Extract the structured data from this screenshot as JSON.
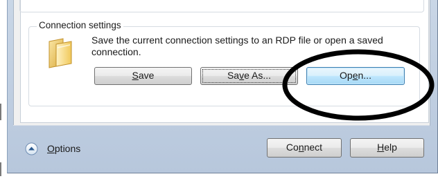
{
  "connection_settings": {
    "legend": "Connection settings",
    "description": "Save the current connection settings to an RDP file or open a saved connection.",
    "icon": "folder-icon",
    "save_button": {
      "pre": "",
      "mnemonic": "S",
      "post": "ave"
    },
    "save_as_button": {
      "pre": "Sa",
      "mnemonic": "v",
      "post": "e As..."
    },
    "open_button": {
      "pre": "Op",
      "mnemonic": "e",
      "post": "n..."
    }
  },
  "footer": {
    "options_icon": "chevron-up-circle-icon",
    "options_label": {
      "pre": "",
      "mnemonic": "O",
      "post": "ptions"
    },
    "connect_button": {
      "pre": "Co",
      "mnemonic": "n",
      "post": "nect"
    },
    "help_button": {
      "pre": "",
      "mnemonic": "H",
      "post": "elp"
    }
  },
  "colors": {
    "window_frame": "#b7c7dc",
    "dialog_background": "#f0f0f0",
    "default_button_border": "#3c7fb1",
    "annotation_ring": "#000000"
  }
}
